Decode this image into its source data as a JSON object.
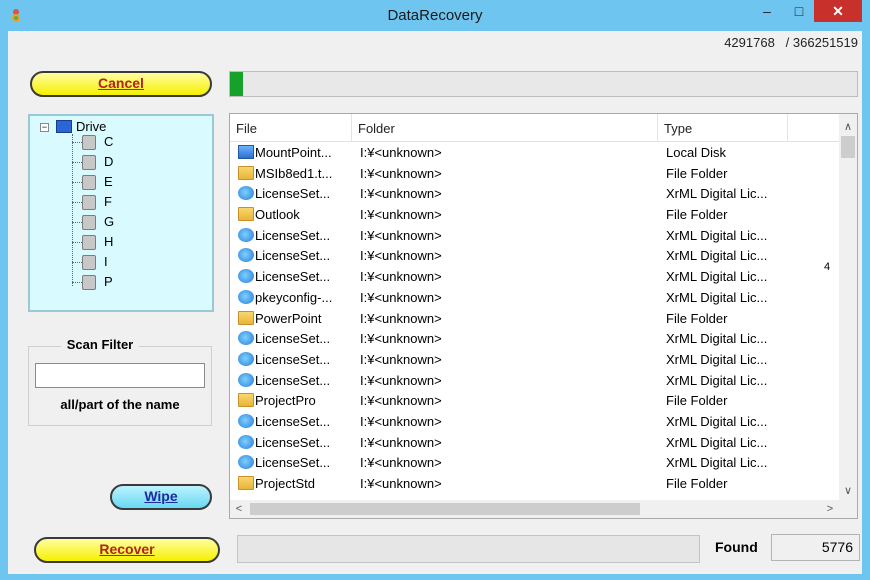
{
  "window": {
    "title": "DataRecovery",
    "controls": {
      "minimize": "–",
      "maximize": "□",
      "close": "✕"
    }
  },
  "counter": {
    "current": "4291768",
    "separator": "/",
    "total": "366251519"
  },
  "buttons": {
    "cancel": "Cancel",
    "wipe": "Wipe",
    "recover": "Recover"
  },
  "progress_top": {
    "fraction": 0.003
  },
  "tree": {
    "root": "Drive",
    "drives": [
      "C",
      "D",
      "E",
      "F",
      "G",
      "H",
      "I",
      "P"
    ]
  },
  "filter": {
    "title": "Scan Filter",
    "value": "",
    "hint": "all/part of the name"
  },
  "list": {
    "columns": [
      "File",
      "Folder",
      "Type"
    ],
    "rows": [
      {
        "icon": "disk",
        "file": "MountPoint...",
        "folder": "I:¥<unknown>",
        "type": "Local Disk"
      },
      {
        "icon": "folder",
        "file": "MSIb8ed1.t...",
        "folder": "I:¥<unknown>",
        "type": "File Folder"
      },
      {
        "icon": "xrml",
        "file": "LicenseSet...",
        "folder": "I:¥<unknown>",
        "type": "XrML Digital Lic..."
      },
      {
        "icon": "folder",
        "file": "Outlook",
        "folder": "I:¥<unknown>",
        "type": "File Folder"
      },
      {
        "icon": "xrml",
        "file": "LicenseSet...",
        "folder": "I:¥<unknown>",
        "type": "XrML Digital Lic..."
      },
      {
        "icon": "xrml",
        "file": "LicenseSet...",
        "folder": "I:¥<unknown>",
        "type": "XrML Digital Lic..."
      },
      {
        "icon": "xrml",
        "file": "LicenseSet...",
        "folder": "I:¥<unknown>",
        "type": "XrML Digital Lic..."
      },
      {
        "icon": "xrml",
        "file": "pkeyconfig-...",
        "folder": "I:¥<unknown>",
        "type": "XrML Digital Lic..."
      },
      {
        "icon": "folder",
        "file": "PowerPoint",
        "folder": "I:¥<unknown>",
        "type": "File Folder"
      },
      {
        "icon": "xrml",
        "file": "LicenseSet...",
        "folder": "I:¥<unknown>",
        "type": "XrML Digital Lic..."
      },
      {
        "icon": "xrml",
        "file": "LicenseSet...",
        "folder": "I:¥<unknown>",
        "type": "XrML Digital Lic..."
      },
      {
        "icon": "xrml",
        "file": "LicenseSet...",
        "folder": "I:¥<unknown>",
        "type": "XrML Digital Lic..."
      },
      {
        "icon": "folder",
        "file": "ProjectPro",
        "folder": "I:¥<unknown>",
        "type": "File Folder"
      },
      {
        "icon": "xrml",
        "file": "LicenseSet...",
        "folder": "I:¥<unknown>",
        "type": "XrML Digital Lic..."
      },
      {
        "icon": "xrml",
        "file": "LicenseSet...",
        "folder": "I:¥<unknown>",
        "type": "XrML Digital Lic..."
      },
      {
        "icon": "xrml",
        "file": "LicenseSet...",
        "folder": "I:¥<unknown>",
        "type": "XrML Digital Lic..."
      },
      {
        "icon": "folder",
        "file": "ProjectStd",
        "folder": "I:¥<unknown>",
        "type": "File Folder"
      }
    ],
    "edge_mark": "4"
  },
  "status": {
    "found_label": "Found",
    "found_value": "5776"
  },
  "colors": {
    "title_bar": "#6ec6f0",
    "close_button": "#c7302b",
    "tree_bg": "#d9fbff",
    "button_yellow": "#f6f000",
    "button_cyan": "#68d8f2"
  }
}
